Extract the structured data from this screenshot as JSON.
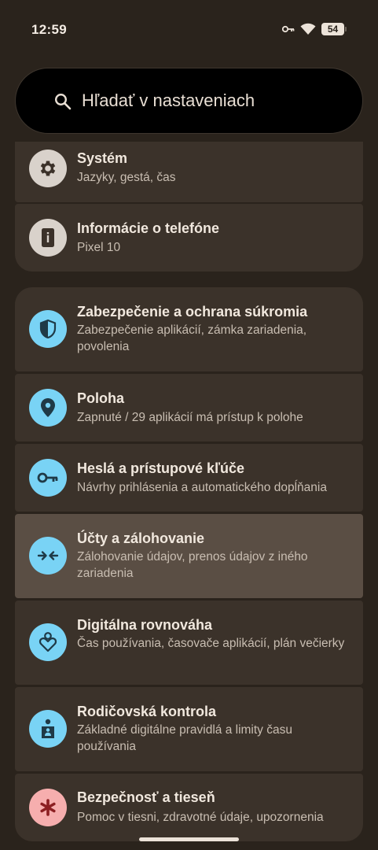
{
  "status_bar": {
    "time": "12:59",
    "battery_level": "54"
  },
  "search": {
    "placeholder": "Hľadať v nastaveniach"
  },
  "settings": [
    {
      "title": "Systém",
      "subtitle": "Jazyky, gestá, čas",
      "icon": "gear-icon"
    },
    {
      "title": "Informácie o telefóne",
      "subtitle": "Pixel 10",
      "icon": "phone-info-icon"
    },
    {
      "title": "Zabezpečenie a ochrana súkromia",
      "subtitle": "Zabezpečenie aplikácií, zámka zariadenia, povolenia",
      "icon": "shield-icon"
    },
    {
      "title": "Poloha",
      "subtitle": "Zapnuté / 29 aplikácií má prístup k polohe",
      "icon": "location-pin-icon"
    },
    {
      "title": "Heslá a prístupové kľúče",
      "subtitle": "Návrhy prihlásenia a automatického dopĺňania",
      "icon": "key-icon"
    },
    {
      "title": "Účty a zálohovanie",
      "subtitle": "Zálohovanie údajov, prenos údajov z iného zariadenia",
      "icon": "transfer-arrows-icon"
    },
    {
      "title": "Digitálna rovnováha",
      "subtitle": "Čas používania, časovače aplikácií, plán večierky",
      "icon": "digital-wellbeing-icon"
    },
    {
      "title": "Rodičovská kontrola",
      "subtitle": "Základné digitálne pravidlá a limity času používania",
      "icon": "family-icon"
    },
    {
      "title": "Bezpečnosť a tieseň",
      "subtitle": "Pomoc v tiesni, zdravotné údaje, upozornenia",
      "icon": "asterisk-icon"
    }
  ],
  "colors": {
    "background": "#2a231c",
    "card": "#3b322a",
    "highlight": "#5a4e44",
    "icon_blue": "#79d3f5",
    "icon_grey": "#d9d2cb",
    "icon_red": "#f6aeae"
  }
}
